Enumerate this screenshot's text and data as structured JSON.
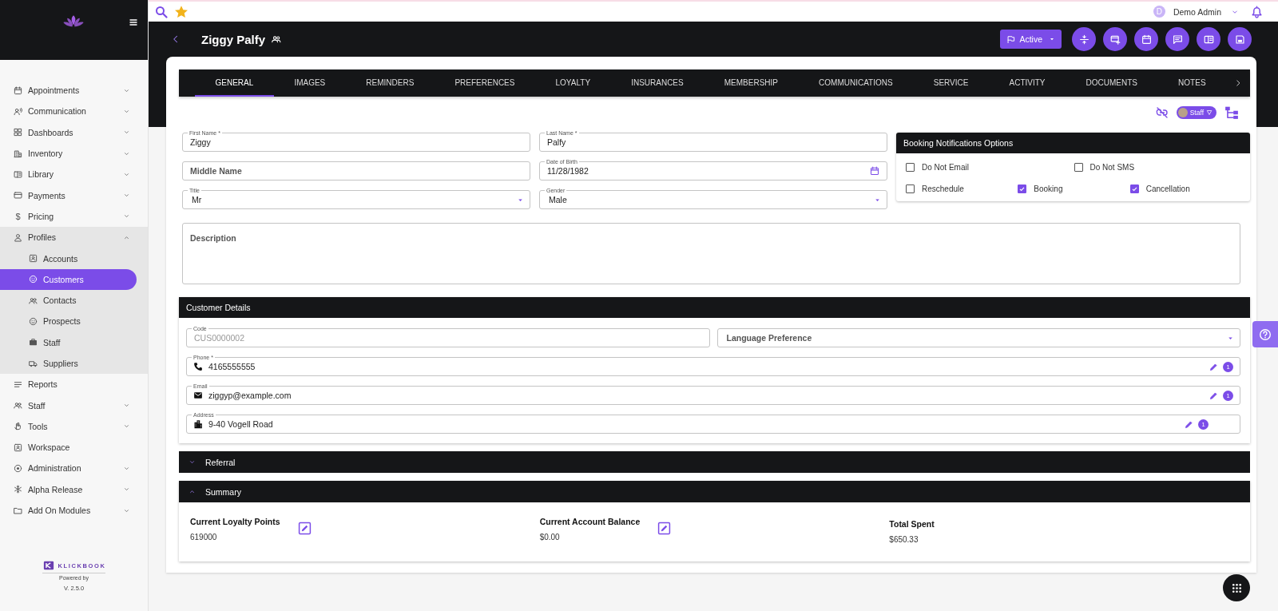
{
  "sidebar": {
    "items": [
      {
        "label": "Appointments",
        "expanded": false
      },
      {
        "label": "Communication",
        "expanded": false
      },
      {
        "label": "Dashboards",
        "expanded": false
      },
      {
        "label": "Inventory",
        "expanded": false
      },
      {
        "label": "Library",
        "expanded": false
      },
      {
        "label": "Payments",
        "expanded": false
      },
      {
        "label": "Pricing",
        "icon_glyph": "$",
        "expanded": false
      },
      {
        "label": "Profiles",
        "expanded": true,
        "children": [
          {
            "label": "Accounts",
            "selected": false
          },
          {
            "label": "Customers",
            "selected": true
          },
          {
            "label": "Contacts",
            "selected": false
          },
          {
            "label": "Prospects",
            "selected": false
          },
          {
            "label": "Staff",
            "selected": false
          },
          {
            "label": "Suppliers",
            "selected": false
          }
        ]
      },
      {
        "label": "Reports"
      },
      {
        "label": "Staff",
        "expanded": false
      },
      {
        "label": "Tools",
        "expanded": false
      },
      {
        "label": "Workspace"
      },
      {
        "label": "Administration",
        "expanded": false
      },
      {
        "label": "Alpha Release",
        "expanded": false
      },
      {
        "label": "Add On Modules",
        "expanded": false
      }
    ],
    "brand": "KLICKBOOK",
    "powered_by": "Powered by",
    "version": "V. 2.5.0"
  },
  "topbar": {
    "user_initial": "D",
    "user_name": "Demo Admin"
  },
  "header": {
    "title": "Ziggy Palfy",
    "status_button": "Active"
  },
  "tabs": [
    {
      "label": "GENERAL",
      "selected": true
    },
    {
      "label": "IMAGES",
      "selected": false
    },
    {
      "label": "REMINDERS",
      "selected": false
    },
    {
      "label": "PREFERENCES",
      "selected": false
    },
    {
      "label": "LOYALTY",
      "selected": false
    },
    {
      "label": "INSURANCES",
      "selected": false
    },
    {
      "label": "MEMBERSHIP",
      "selected": false
    },
    {
      "label": "COMMUNICATIONS",
      "selected": false
    },
    {
      "label": "SERVICE",
      "selected": false
    },
    {
      "label": "ACTIVITY",
      "selected": false
    },
    {
      "label": "DOCUMENTS",
      "selected": false
    },
    {
      "label": "NOTES",
      "selected": false
    }
  ],
  "toolbar": {
    "staff_chip": "Staff"
  },
  "field_rows": [
    [
      {
        "kind": "text",
        "label": "First Name *",
        "value": "Ziggy"
      },
      {
        "kind": "text",
        "label": "Last Name *",
        "value": "Palfy"
      }
    ],
    [
      {
        "kind": "text",
        "placeholder": "Middle Name"
      },
      {
        "kind": "date",
        "label": "Date of Birth",
        "value": "11/28/1982"
      }
    ],
    [
      {
        "kind": "select",
        "label": "Title",
        "value": "Mr"
      },
      {
        "kind": "select",
        "label": "Gender",
        "value": "Male"
      }
    ]
  ],
  "description": {
    "kind": "textarea",
    "placeholder": "Description"
  },
  "booking_options": {
    "title": "Booking Notifications Options",
    "rows": [
      [
        {
          "label": "Do Not Email",
          "checked": false
        },
        {
          "label": "Do Not SMS",
          "checked": false
        }
      ],
      [
        {
          "label": "Reschedule",
          "checked": false
        },
        {
          "label": "Booking",
          "checked": true
        },
        {
          "label": "Cancellation",
          "checked": true
        }
      ]
    ]
  },
  "customer_details": {
    "title": "Customer Details",
    "code": {
      "label": "Code",
      "value": "CUS0000002",
      "disabled": true
    },
    "language": {
      "placeholder": "Language Preference"
    },
    "contacts": [
      {
        "kind": "phone",
        "label": "Phone *",
        "value": "4165555555",
        "count": "1"
      },
      {
        "kind": "email",
        "label": "Email",
        "value": "ziggyp@example.com",
        "count": "1"
      },
      {
        "kind": "address",
        "label": "Address",
        "value": "9-40 Vogell Road",
        "count": "1"
      }
    ]
  },
  "sections": [
    {
      "title": "Referral",
      "expanded": false
    },
    {
      "title": "Summary",
      "expanded": true
    }
  ],
  "summary": [
    {
      "label": "Current Loyalty Points",
      "value": "619000",
      "editable": true
    },
    {
      "label": "Current Account Balance",
      "value": "$0.00",
      "editable": true
    },
    {
      "label": "Total Spent",
      "value": "$650.33",
      "editable": false
    }
  ]
}
